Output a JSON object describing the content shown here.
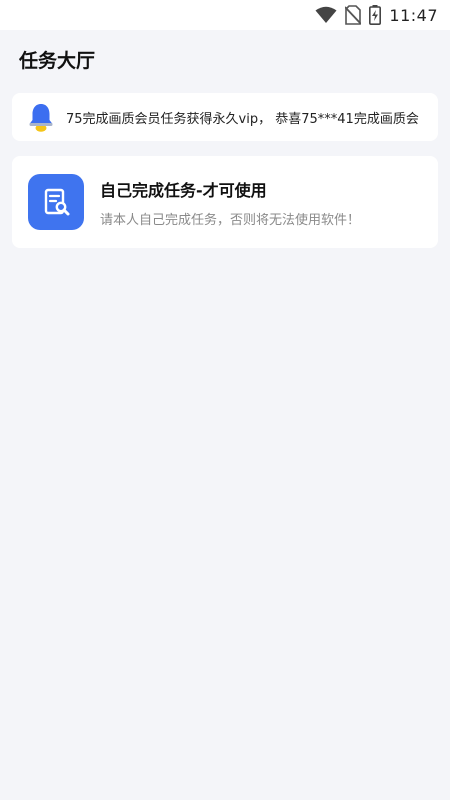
{
  "status_bar": {
    "time": "11:47",
    "icons": [
      "wifi-icon",
      "no-sim-icon",
      "battery-charging-icon"
    ]
  },
  "header": {
    "title": "任务大厅"
  },
  "notice": {
    "icon": "bell-icon",
    "text": "75完成画质会员任务获得永久vip， 恭喜75***41完成画质会"
  },
  "tasks": [
    {
      "icon": "task-wrench-icon",
      "title": "自己完成任务-才可使用",
      "description": "请本人自己完成任务，否则将无法使用软件！"
    }
  ],
  "colors": {
    "background": "#f4f5f9",
    "card": "#ffffff",
    "accent": "#3f74ef",
    "bell_blue": "#3c6ef0",
    "bell_yellow": "#f5c518",
    "muted_text": "#8a8a8a"
  }
}
